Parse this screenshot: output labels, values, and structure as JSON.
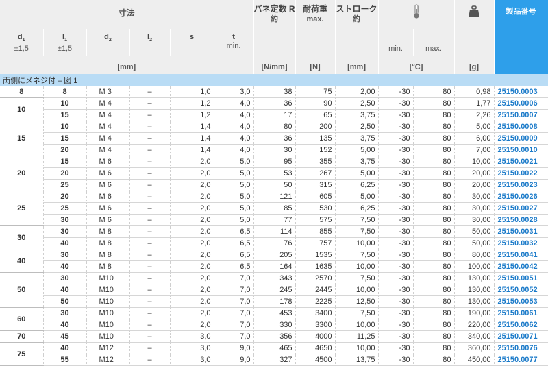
{
  "header": {
    "dimensions_group": "寸法",
    "d1_symbol": "d",
    "d1_sub": "1",
    "d1_tol": "±1,5",
    "l1_symbol": "l",
    "l1_sub": "1",
    "l1_tol": "±1,5",
    "d2_symbol": "d",
    "d2_sub": "2",
    "l2_symbol": "l",
    "l2_sub": "2",
    "s_symbol": "s",
    "t_symbol": "t",
    "t_sub": "min.",
    "mm_unit": "[mm]",
    "spring_title": "バネ定数 R",
    "spring_sub": "約",
    "spring_unit": "[N/mm]",
    "load_title": "耐荷重",
    "load_sub": "max.",
    "load_unit": "[N]",
    "stroke_title": "ストローク",
    "stroke_sub": "約",
    "stroke_unit": "[mm]",
    "temp_min": "min.",
    "temp_max": "max.",
    "temp_unit": "[°C]",
    "weight_unit": "[g]",
    "product_number": "製品番号",
    "thermometer_icon": "thermometer-icon",
    "weight_icon": "weight-icon"
  },
  "section_label": "両側にメネジ付 – 図 1",
  "rows": [
    {
      "d1": "8",
      "l1": "8",
      "d2": "M 3",
      "l2": "–",
      "s": "1,0",
      "t": "3,0",
      "r": "38",
      "load": "75",
      "stroke": "2,00",
      "tmin": "-30",
      "tmax": "80",
      "g": "0,98",
      "pn": "25150.0003"
    },
    {
      "d1": "10",
      "l1": "10",
      "d2": "M 4",
      "l2": "–",
      "s": "1,2",
      "t": "4,0",
      "r": "36",
      "load": "90",
      "stroke": "2,50",
      "tmin": "-30",
      "tmax": "80",
      "g": "1,77",
      "pn": "25150.0006"
    },
    {
      "d1": "",
      "l1": "15",
      "d2": "M 4",
      "l2": "–",
      "s": "1,2",
      "t": "4,0",
      "r": "17",
      "load": "65",
      "stroke": "3,75",
      "tmin": "-30",
      "tmax": "80",
      "g": "2,26",
      "pn": "25150.0007"
    },
    {
      "d1": "15",
      "l1": "10",
      "d2": "M 4",
      "l2": "–",
      "s": "1,4",
      "t": "4,0",
      "r": "80",
      "load": "200",
      "stroke": "2,50",
      "tmin": "-30",
      "tmax": "80",
      "g": "5,00",
      "pn": "25150.0008"
    },
    {
      "d1": "",
      "l1": "15",
      "d2": "M 4",
      "l2": "–",
      "s": "1,4",
      "t": "4,0",
      "r": "36",
      "load": "135",
      "stroke": "3,75",
      "tmin": "-30",
      "tmax": "80",
      "g": "6,00",
      "pn": "25150.0009"
    },
    {
      "d1": "",
      "l1": "20",
      "d2": "M 4",
      "l2": "–",
      "s": "1,4",
      "t": "4,0",
      "r": "30",
      "load": "152",
      "stroke": "5,00",
      "tmin": "-30",
      "tmax": "80",
      "g": "7,00",
      "pn": "25150.0010"
    },
    {
      "d1": "20",
      "l1": "15",
      "d2": "M 6",
      "l2": "–",
      "s": "2,0",
      "t": "5,0",
      "r": "95",
      "load": "355",
      "stroke": "3,75",
      "tmin": "-30",
      "tmax": "80",
      "g": "10,00",
      "pn": "25150.0021"
    },
    {
      "d1": "",
      "l1": "20",
      "d2": "M 6",
      "l2": "–",
      "s": "2,0",
      "t": "5,0",
      "r": "53",
      "load": "267",
      "stroke": "5,00",
      "tmin": "-30",
      "tmax": "80",
      "g": "20,00",
      "pn": "25150.0022"
    },
    {
      "d1": "",
      "l1": "25",
      "d2": "M 6",
      "l2": "–",
      "s": "2,0",
      "t": "5,0",
      "r": "50",
      "load": "315",
      "stroke": "6,25",
      "tmin": "-30",
      "tmax": "80",
      "g": "20,00",
      "pn": "25150.0023"
    },
    {
      "d1": "25",
      "l1": "20",
      "d2": "M 6",
      "l2": "–",
      "s": "2,0",
      "t": "5,0",
      "r": "121",
      "load": "605",
      "stroke": "5,00",
      "tmin": "-30",
      "tmax": "80",
      "g": "30,00",
      "pn": "25150.0026"
    },
    {
      "d1": "",
      "l1": "25",
      "d2": "M 6",
      "l2": "–",
      "s": "2,0",
      "t": "5,0",
      "r": "85",
      "load": "530",
      "stroke": "6,25",
      "tmin": "-30",
      "tmax": "80",
      "g": "30,00",
      "pn": "25150.0027"
    },
    {
      "d1": "",
      "l1": "30",
      "d2": "M 6",
      "l2": "–",
      "s": "2,0",
      "t": "5,0",
      "r": "77",
      "load": "575",
      "stroke": "7,50",
      "tmin": "-30",
      "tmax": "80",
      "g": "30,00",
      "pn": "25150.0028"
    },
    {
      "d1": "30",
      "l1": "30",
      "d2": "M 8",
      "l2": "–",
      "s": "2,0",
      "t": "6,5",
      "r": "114",
      "load": "855",
      "stroke": "7,50",
      "tmin": "-30",
      "tmax": "80",
      "g": "50,00",
      "pn": "25150.0031"
    },
    {
      "d1": "",
      "l1": "40",
      "d2": "M 8",
      "l2": "–",
      "s": "2,0",
      "t": "6,5",
      "r": "76",
      "load": "757",
      "stroke": "10,00",
      "tmin": "-30",
      "tmax": "80",
      "g": "50,00",
      "pn": "25150.0032"
    },
    {
      "d1": "40",
      "l1": "30",
      "d2": "M 8",
      "l2": "–",
      "s": "2,0",
      "t": "6,5",
      "r": "205",
      "load": "1535",
      "stroke": "7,50",
      "tmin": "-30",
      "tmax": "80",
      "g": "80,00",
      "pn": "25150.0041"
    },
    {
      "d1": "",
      "l1": "40",
      "d2": "M 8",
      "l2": "–",
      "s": "2,0",
      "t": "6,5",
      "r": "164",
      "load": "1635",
      "stroke": "10,00",
      "tmin": "-30",
      "tmax": "80",
      "g": "100,00",
      "pn": "25150.0042"
    },
    {
      "d1": "50",
      "l1": "30",
      "d2": "M10",
      "l2": "–",
      "s": "2,0",
      "t": "7,0",
      "r": "343",
      "load": "2570",
      "stroke": "7,50",
      "tmin": "-30",
      "tmax": "80",
      "g": "130,00",
      "pn": "25150.0051"
    },
    {
      "d1": "",
      "l1": "40",
      "d2": "M10",
      "l2": "–",
      "s": "2,0",
      "t": "7,0",
      "r": "245",
      "load": "2445",
      "stroke": "10,00",
      "tmin": "-30",
      "tmax": "80",
      "g": "130,00",
      "pn": "25150.0052"
    },
    {
      "d1": "",
      "l1": "50",
      "d2": "M10",
      "l2": "–",
      "s": "2,0",
      "t": "7,0",
      "r": "178",
      "load": "2225",
      "stroke": "12,50",
      "tmin": "-30",
      "tmax": "80",
      "g": "130,00",
      "pn": "25150.0053"
    },
    {
      "d1": "60",
      "l1": "30",
      "d2": "M10",
      "l2": "–",
      "s": "2,0",
      "t": "7,0",
      "r": "453",
      "load": "3400",
      "stroke": "7,50",
      "tmin": "-30",
      "tmax": "80",
      "g": "190,00",
      "pn": "25150.0061"
    },
    {
      "d1": "",
      "l1": "40",
      "d2": "M10",
      "l2": "–",
      "s": "2,0",
      "t": "7,0",
      "r": "330",
      "load": "3300",
      "stroke": "10,00",
      "tmin": "-30",
      "tmax": "80",
      "g": "220,00",
      "pn": "25150.0062"
    },
    {
      "d1": "70",
      "l1": "45",
      "d2": "M10",
      "l2": "–",
      "s": "3,0",
      "t": "7,0",
      "r": "356",
      "load": "4000",
      "stroke": "11,25",
      "tmin": "-30",
      "tmax": "80",
      "g": "340,00",
      "pn": "25150.0071"
    },
    {
      "d1": "75",
      "l1": "40",
      "d2": "M12",
      "l2": "–",
      "s": "3,0",
      "t": "9,0",
      "r": "465",
      "load": "4650",
      "stroke": "10,00",
      "tmin": "-30",
      "tmax": "80",
      "g": "360,00",
      "pn": "25150.0076"
    },
    {
      "d1": "",
      "l1": "55",
      "d2": "M12",
      "l2": "–",
      "s": "3,0",
      "t": "9,0",
      "r": "327",
      "load": "4500",
      "stroke": "13,75",
      "tmin": "-30",
      "tmax": "80",
      "g": "450,00",
      "pn": "25150.0077"
    }
  ],
  "groups": [
    {
      "d1": "8",
      "start": 0,
      "span": 1
    },
    {
      "d1": "10",
      "start": 1,
      "span": 2
    },
    {
      "d1": "15",
      "start": 3,
      "span": 3
    },
    {
      "d1": "20",
      "start": 6,
      "span": 3
    },
    {
      "d1": "25",
      "start": 9,
      "span": 3
    },
    {
      "d1": "30",
      "start": 12,
      "span": 2
    },
    {
      "d1": "40",
      "start": 14,
      "span": 2
    },
    {
      "d1": "50",
      "start": 16,
      "span": 3
    },
    {
      "d1": "60",
      "start": 19,
      "span": 2
    },
    {
      "d1": "70",
      "start": 21,
      "span": 1
    },
    {
      "d1": "75",
      "start": 22,
      "span": 2
    }
  ],
  "colors": {
    "header_bg": "#eeeeee",
    "product_header_bg": "#2e9fea",
    "section_bg": "#b9dcf5",
    "part_number_text": "#1a7ac9"
  }
}
